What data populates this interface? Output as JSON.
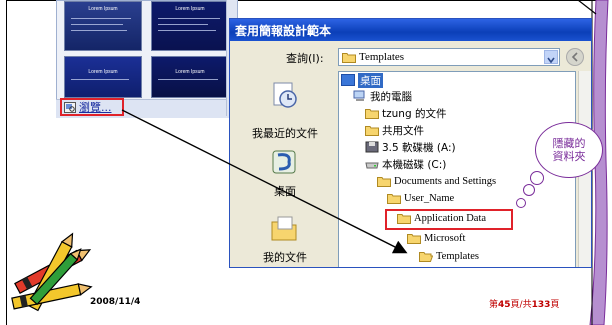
{
  "thumbnails": {
    "items": [
      {
        "title": "Lorem Ipsum"
      },
      {
        "title": "Lorem Ipsum"
      },
      {
        "title": "Lorem Ipsum"
      },
      {
        "title": "Lorem Ipsum"
      }
    ],
    "browse_label": "瀏覽..."
  },
  "dialog": {
    "title": "套用簡報設計範本",
    "look_in_label": "查詢(I):",
    "look_in_value": "Templates",
    "places": [
      {
        "label": "我最近的文件",
        "icon": "recent-documents-icon"
      },
      {
        "label": "桌面",
        "icon": "desktop-icon"
      },
      {
        "label": "我的文件",
        "icon": "my-documents-icon"
      }
    ],
    "tree": [
      {
        "label": "桌面",
        "icon": "desktop-icon",
        "selected": true
      },
      {
        "label": "我的電腦",
        "icon": "my-computer-icon"
      },
      {
        "label": "tzung 的文件",
        "icon": "folder-icon"
      },
      {
        "label": "共用文件",
        "icon": "folder-icon"
      },
      {
        "label": "3.5 軟碟機 (A:)",
        "icon": "floppy-drive-icon"
      },
      {
        "label": "本機磁碟 (C:)",
        "icon": "hard-drive-icon"
      },
      {
        "label": "Documents and Settings",
        "icon": "folder-icon"
      },
      {
        "label": "User_Name",
        "icon": "folder-icon"
      },
      {
        "label": "Application Data",
        "icon": "folder-icon"
      },
      {
        "label": "Microsoft",
        "icon": "folder-icon"
      },
      {
        "label": "Templates",
        "icon": "open-folder-icon"
      }
    ]
  },
  "callout": {
    "line1": "隱藏的",
    "line2": "資料夾"
  },
  "footer": {
    "date": "2008/11/4",
    "page_prefix": "第",
    "page_current": "45",
    "page_mid": "頁/共",
    "page_total": "133",
    "page_suffix": "頁"
  },
  "colors": {
    "accent_purple": "#7a2d9a",
    "highlight_red": "#e0222a",
    "title_blue": "#0b3fb8"
  }
}
